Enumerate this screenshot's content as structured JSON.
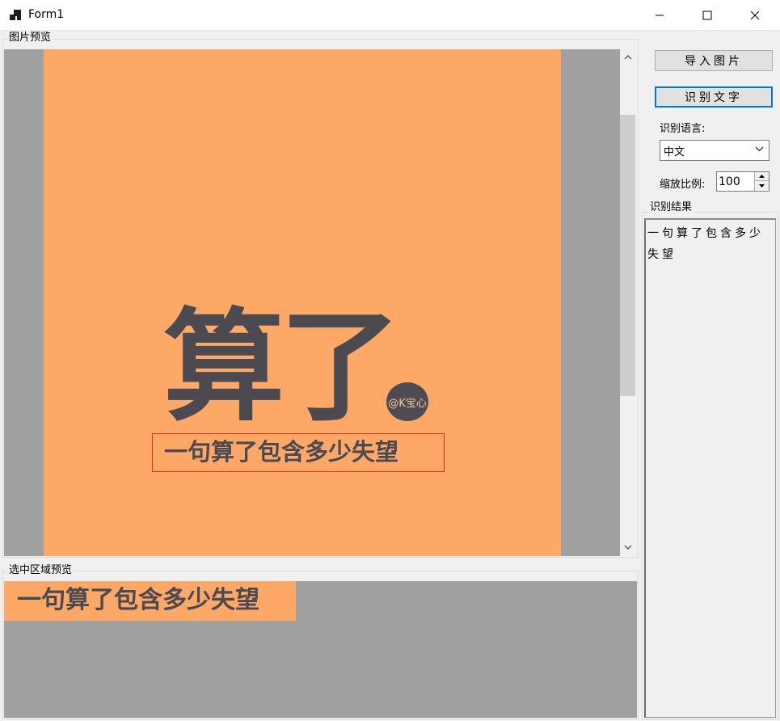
{
  "window": {
    "title": "Form1",
    "app_icon": "windows-form-icon",
    "controls": [
      "minimize-icon",
      "maximize-icon",
      "close-icon"
    ]
  },
  "image_preview": {
    "label": "图片预览",
    "big_text": "算了",
    "sub_text": "一句算了包含多少失望",
    "watermark": "@K宝心"
  },
  "selection_preview": {
    "label": "选中区域预览",
    "text": "一句算了包含多少失望"
  },
  "toolbar": {
    "import_label": "导入图片",
    "recognize_label": "识别文字"
  },
  "language": {
    "label": "识别语言:",
    "selected": "中文"
  },
  "zoom": {
    "label": "缩放比例:",
    "value": "100"
  },
  "result": {
    "label": "识别结果",
    "text": "一句算了包含多少失望"
  },
  "colors": {
    "canvas_bg": "#fea868",
    "text_dark": "#4a4a50",
    "selection_border": "#e03020",
    "focus_border": "#0078d7"
  }
}
